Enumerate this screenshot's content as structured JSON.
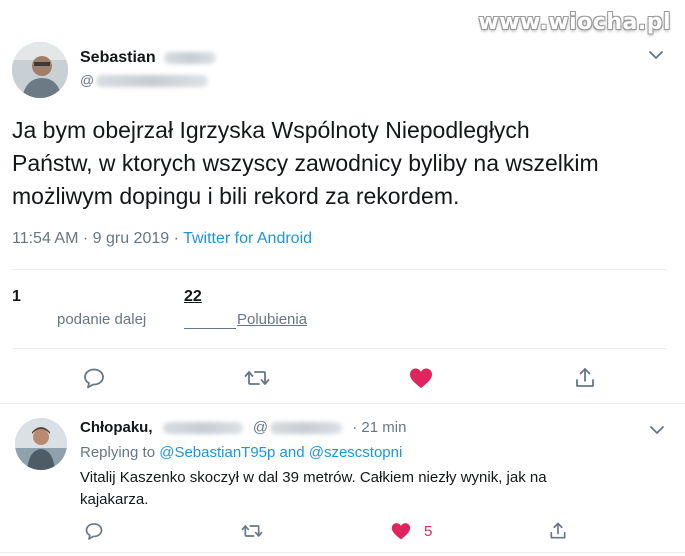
{
  "watermark": "www.wiocha.pl",
  "tweet": {
    "author_name": "Sebastian",
    "handle_prefix": "@",
    "text_lines": [
      "Ja bym obejrzał Igrzyska Wspólnoty Niepodległych",
      "Państw, w ktorych wszyscy zawodnicy byliby na wszelkim",
      "możliwym dopingu i bili rekord za rekordem."
    ],
    "time": "11:54 AM · 9 gru 2019 · ",
    "source": "Twitter for Android",
    "retweets_count": "1",
    "retweets_label": "podanie dalej",
    "likes_count": "22",
    "likes_label": "Polubienia",
    "liked": true
  },
  "reply": {
    "author_name": "Chłopaku,",
    "handle_prefix": "@",
    "time": "· 21 min",
    "replying_to_prefix": "Replying to ",
    "replying_to_users": "@SebastianT95p and @szescstopni",
    "text_lines": [
      "Vitalij Kaszenko skoczył w dal 39 metrów. Całkiem niezły wynik, jak na",
      "kajakarza."
    ],
    "likes_count": "5",
    "liked": true
  },
  "icons": [
    "chevron-down-icon",
    "reply-icon",
    "retweet-icon",
    "heart-icon",
    "share-icon"
  ],
  "colors": {
    "accent": "#1b95e0",
    "like": "#e0245e",
    "secondary_text": "#657786",
    "icon": "#657786",
    "divider": "#e6ecf0"
  }
}
